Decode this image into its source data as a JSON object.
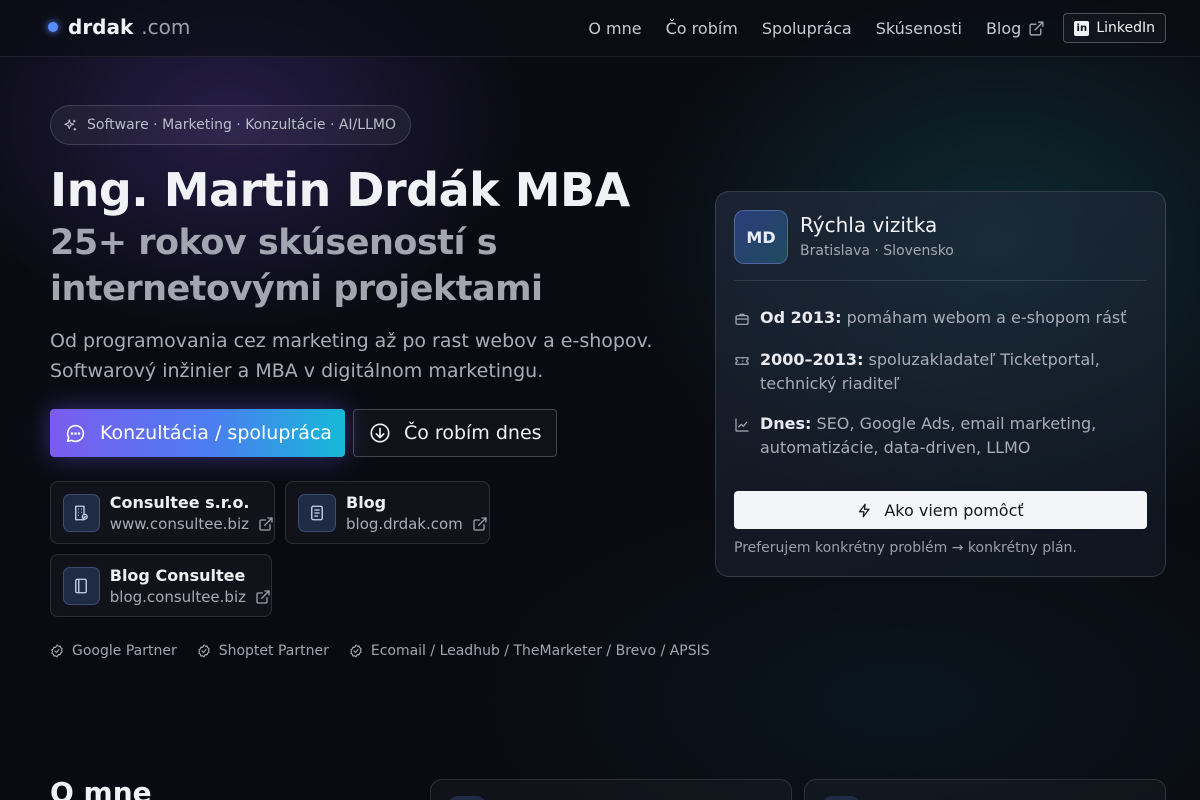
{
  "header": {
    "logo_name": "drdak",
    "logo_tld": ".com",
    "nav": [
      "O mne",
      "Čo robím",
      "Spolupráca",
      "Skúsenosti",
      "Blog"
    ],
    "linkedin_label": "LinkedIn",
    "linkedin_icon": "in"
  },
  "hero": {
    "tagline": "Software · Marketing · Konzultácie · AI/LLMO",
    "name": "Ing. Martin Drdák MBA",
    "subtitle": "25+ rokov skúseností s internetovými projektami",
    "description": "Od programovania cez marketing až po rast webov a e-shopov. Softwarový inžinier a MBA v digitálnom marketingu.",
    "cta_primary": "Konzultácia / spolupráca",
    "cta_secondary": "Čo robím dnes"
  },
  "links": [
    {
      "title": "Consultee s.r.o.",
      "url": "www.consultee.biz",
      "icon": "building-icon"
    },
    {
      "title": "Blog",
      "url": "blog.drdak.com",
      "icon": "document-icon"
    },
    {
      "title": "Blog Consultee",
      "url": "blog.consultee.biz",
      "icon": "notebook-icon"
    }
  ],
  "partners": [
    "Google Partner",
    "Shoptet Partner",
    "Ecomail / Leadhub / TheMarketer / Brevo / APSIS"
  ],
  "card": {
    "avatar": "MD",
    "title": "Rýchla vizitka",
    "location": "Bratislava · Slovensko",
    "rows": [
      {
        "label": "Od 2013:",
        "text": " pomáham webom a e-shopom rásť"
      },
      {
        "label": "2000–2013:",
        "text": " spoluzakladateľ Ticketportal, technický riaditeľ"
      },
      {
        "label": "Dnes:",
        "text": " SEO, Google Ads, email marketing, automatizácie, data-driven, LLMO"
      }
    ],
    "button": "Ako viem pomôcť",
    "note": "Preferujem konkrétny problém → konkrétny plán."
  },
  "section": {
    "title": "O mne"
  },
  "colors": {
    "background": "#0a0b12",
    "accent_start": "#7b5cf0",
    "accent_end": "#16b8d8",
    "logo_dot": "#5b8cff"
  }
}
